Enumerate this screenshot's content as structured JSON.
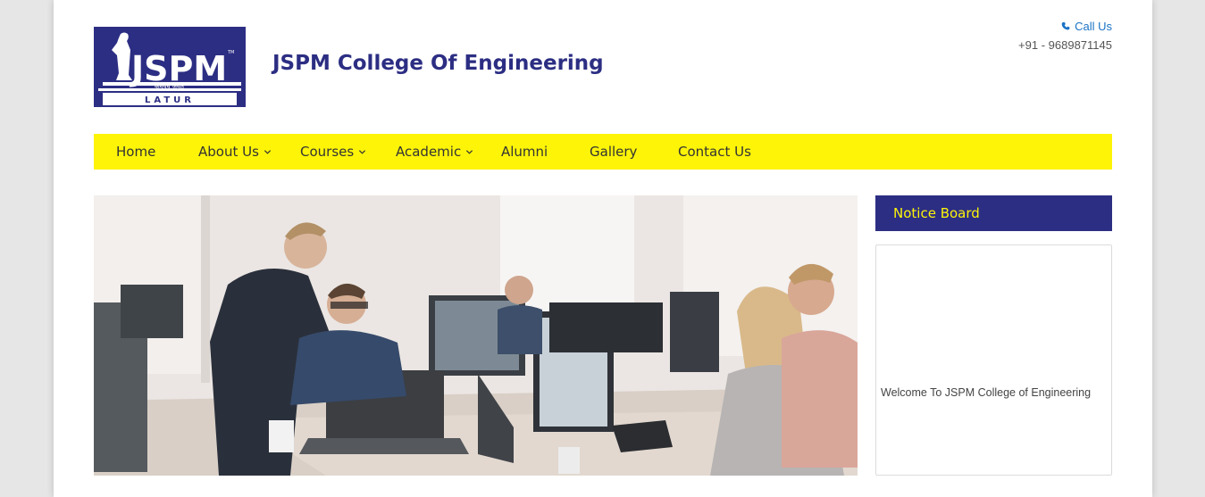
{
  "header": {
    "logo": {
      "text": "JSPM",
      "tagline": "कर्मयेव जयते",
      "location": "LATUR",
      "tm": "TM"
    },
    "site_title": "JSPM College Of Engineering",
    "contact": {
      "call_label": "Call Us",
      "phone": "+91 - 9689871145",
      "icon": "phone-icon"
    }
  },
  "nav": {
    "items": [
      {
        "label": "Home",
        "has_dropdown": false
      },
      {
        "label": "About Us",
        "has_dropdown": true
      },
      {
        "label": "Courses",
        "has_dropdown": true
      },
      {
        "label": "Academic",
        "has_dropdown": true
      },
      {
        "label": "Alumni",
        "has_dropdown": false
      },
      {
        "label": "Gallery",
        "has_dropdown": false
      },
      {
        "label": "Contact Us",
        "has_dropdown": false
      }
    ]
  },
  "notice_board": {
    "title": "Notice Board",
    "marquee_text": "Welcome To JSPM College of Engineering"
  },
  "colors": {
    "brand_navy": "#2c2e83",
    "nav_yellow": "#fdf408",
    "link_blue": "#1a73c6"
  }
}
